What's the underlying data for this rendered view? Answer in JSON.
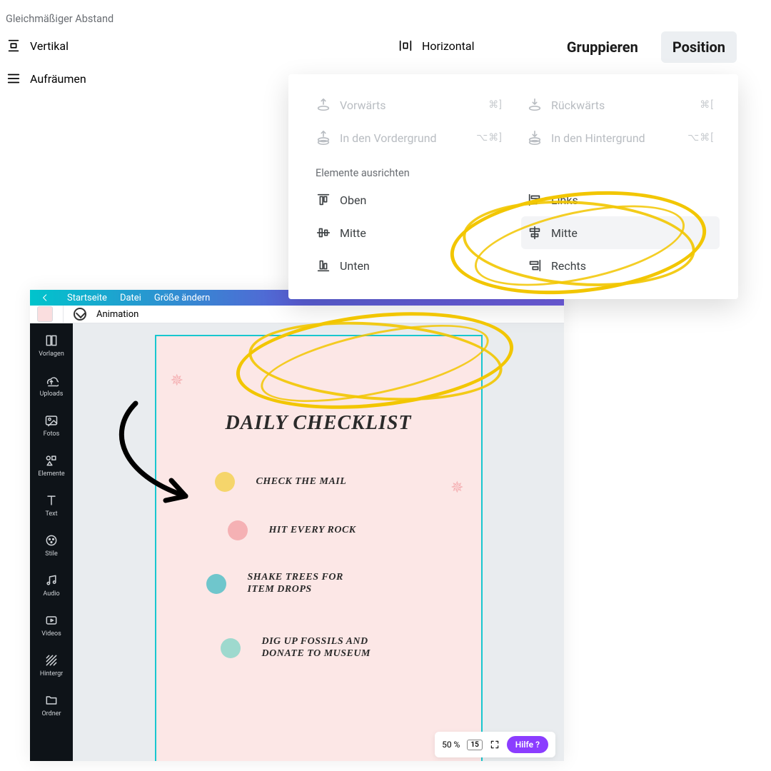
{
  "tabs": {
    "group": "Gruppieren",
    "position": "Position"
  },
  "panel": {
    "forward": {
      "label": "Vorwärts",
      "shortcut": "⌘]"
    },
    "backward": {
      "label": "Rückwärts",
      "shortcut": "⌘["
    },
    "front": {
      "label": "In den Vordergrund",
      "shortcut": "⌥⌘]"
    },
    "back": {
      "label": "In den Hintergrund",
      "shortcut": "⌥⌘["
    },
    "section_align": "Elemente ausrichten",
    "align": {
      "top": "Oben",
      "vmiddle": "Mitte",
      "bottom": "Unten",
      "left": "Links",
      "hcenter": "Mitte",
      "right": "Rechts"
    },
    "section_space": "Gleichmäßiger Abstand",
    "space": {
      "vertical": "Vertikal",
      "horizontal": "Horizontal",
      "tidy": "Aufräumen"
    }
  },
  "editor": {
    "menu": {
      "home": "Startseite",
      "file": "Datei",
      "resize": "Größe ändern"
    },
    "animation": "Animation",
    "sidebar": [
      "Vorlagen",
      "Uploads",
      "Fotos",
      "Elemente",
      "Text",
      "Stile",
      "Audio",
      "Videos",
      "Hintergr",
      "Ordner"
    ],
    "zoom": "50 %",
    "pagecount": "15",
    "help": "Hilfe  ?"
  },
  "checklist": {
    "title": "DAILY CHECKLIST",
    "items": [
      {
        "color": "#F5D56B",
        "text": "CHECK THE MAIL"
      },
      {
        "color": "#F5B1B4",
        "text": "HIT EVERY ROCK"
      },
      {
        "color": "#6FC6CC",
        "text": "SHAKE TREES FOR\nITEM DROPS"
      },
      {
        "color": "#9ED9CE",
        "text": "DIG UP FOSSILS AND\nDONATE TO MUSEUM"
      }
    ]
  }
}
